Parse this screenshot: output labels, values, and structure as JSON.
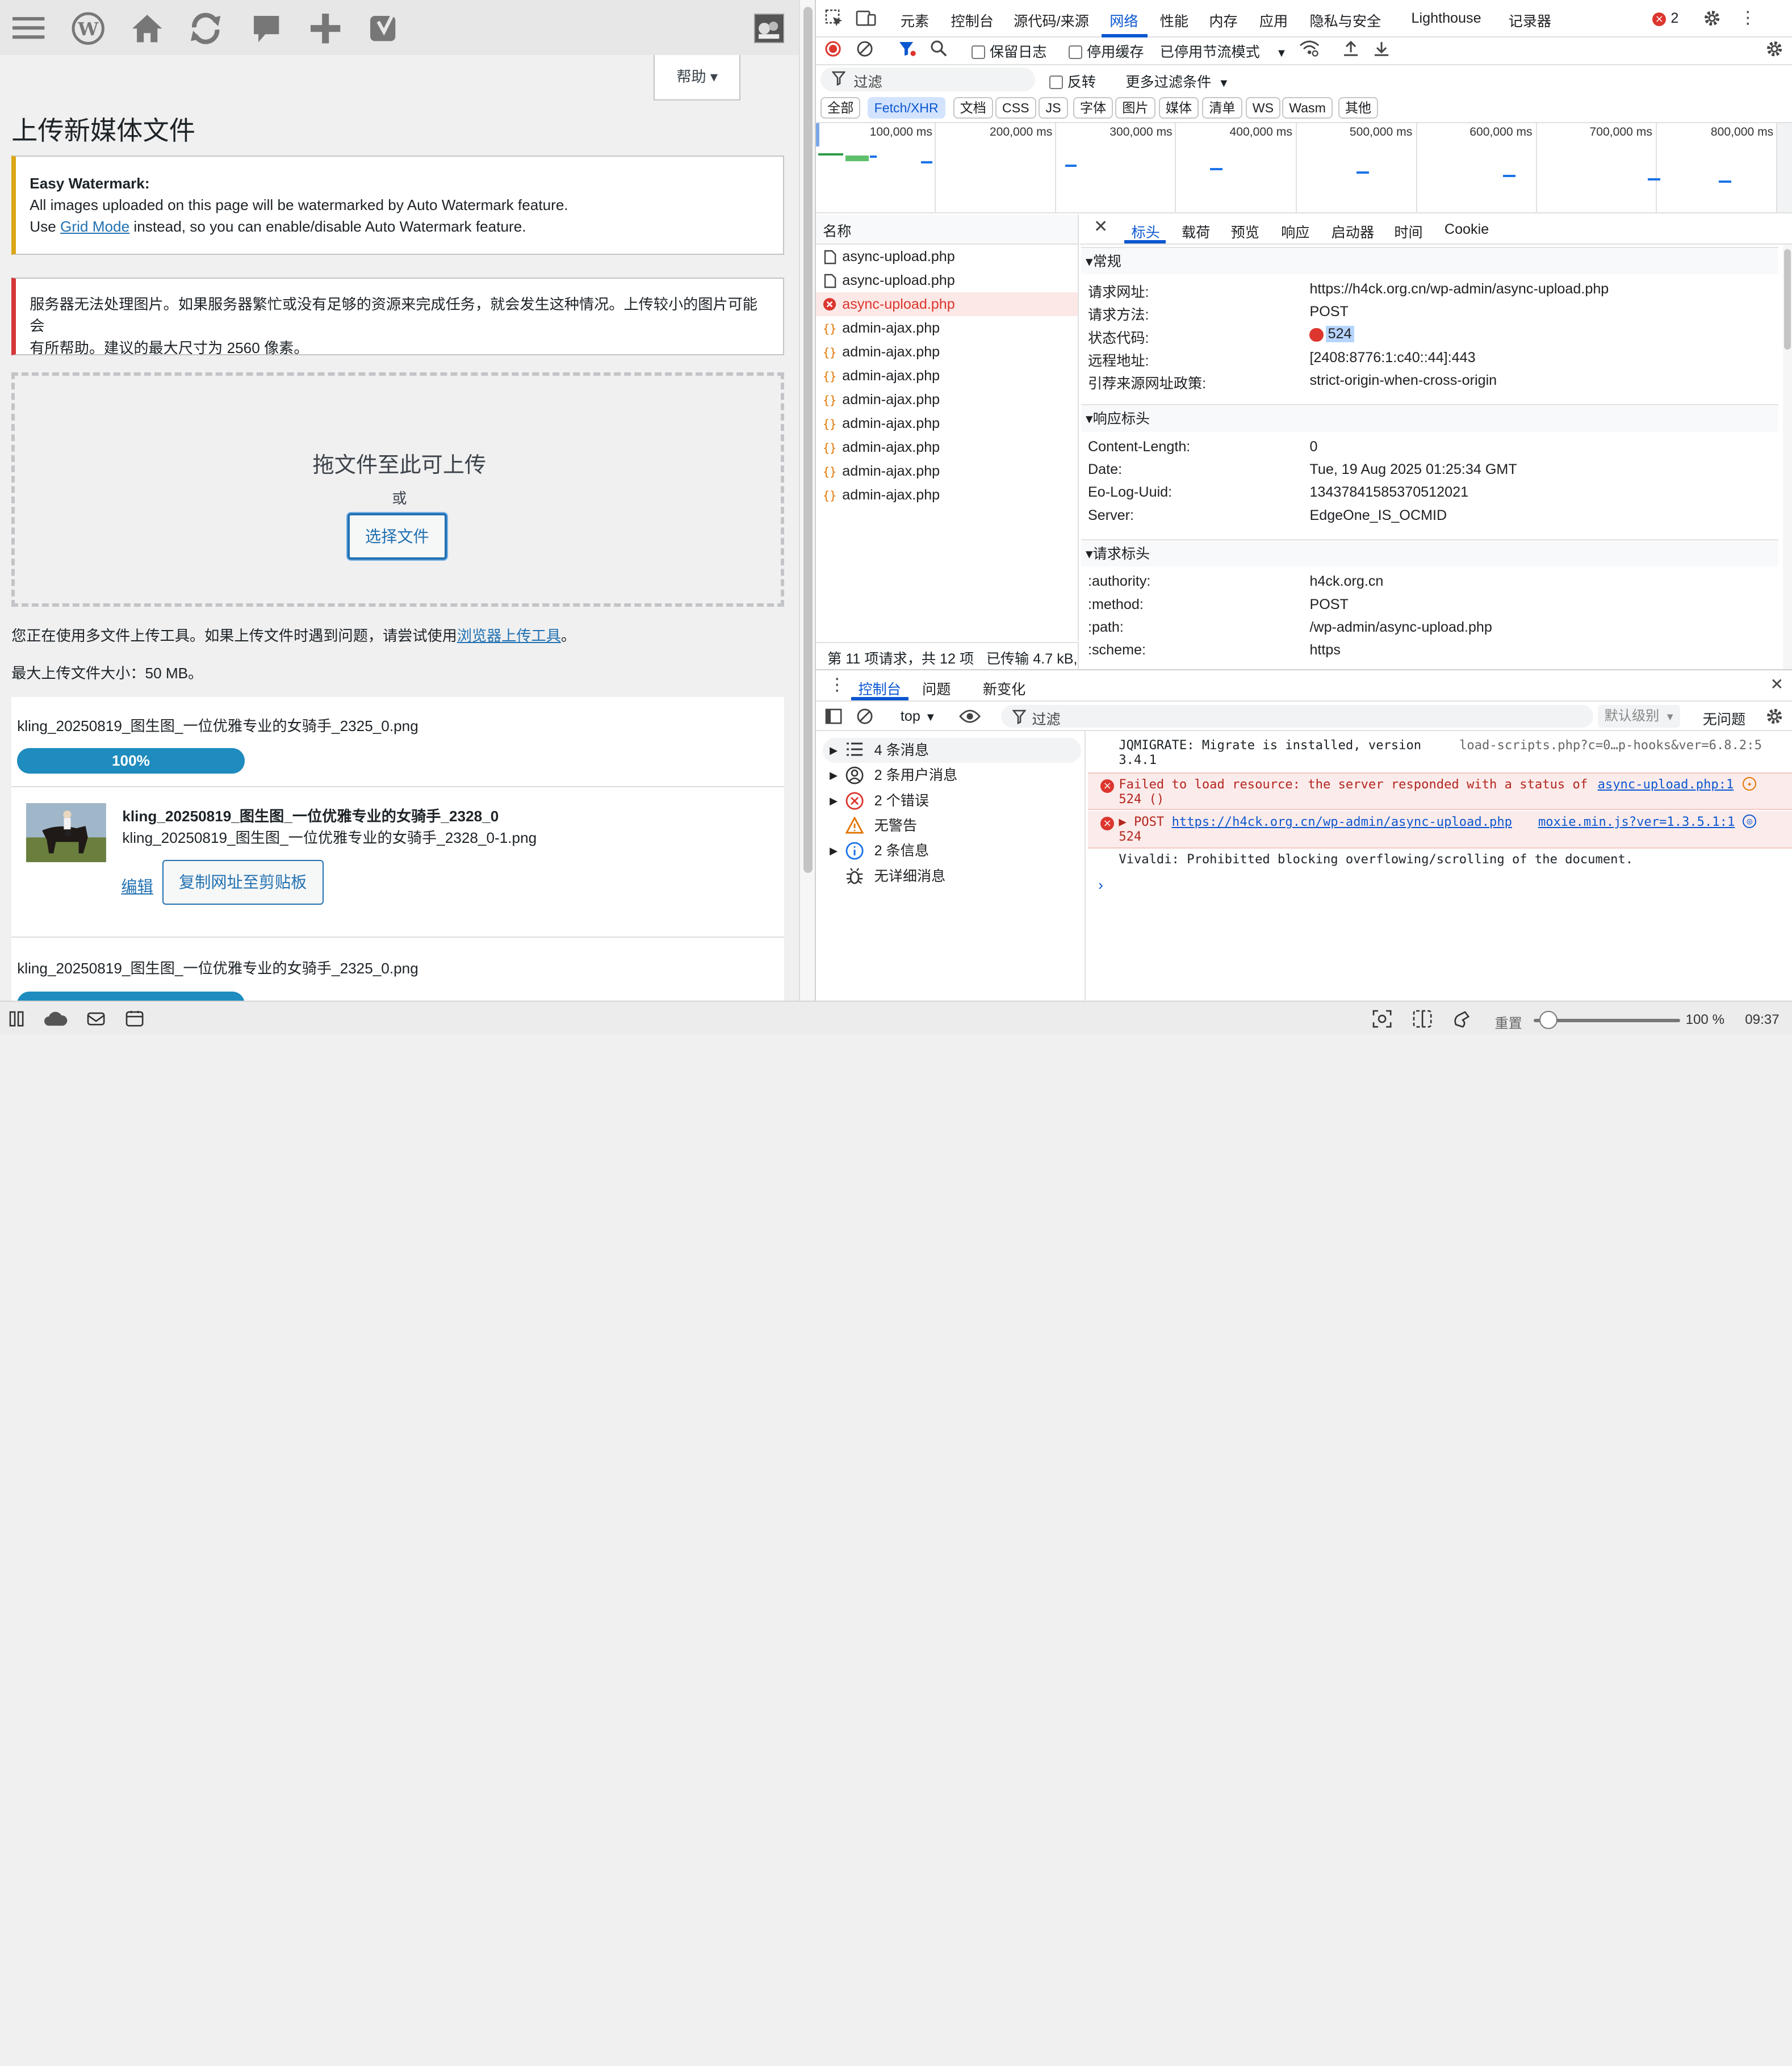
{
  "wp": {
    "help": "帮助",
    "title": "上传新媒体文件",
    "watermark_notice": {
      "title": "Easy Watermark:",
      "line1": "All images uploaded on this page will be watermarked by Auto Watermark feature.",
      "line2_pre": "Use ",
      "line2_link": "Grid Mode",
      "line2_post": " instead, so you can enable/disable Auto Watermark feature."
    },
    "error_notice": {
      "line1": "服务器无法处理图片。如果服务器繁忙或没有足够的资源来完成任务，就会发生这种情况。上传较小的图片可能会",
      "line2": "有所帮助。建议的最大尺寸为 2560 像素。"
    },
    "drop_title": "拖文件至此可上传",
    "drop_or": "或",
    "select_files": "选择文件",
    "multi_uploader_pre": "您正在使用多文件上传工具。如果上传文件时遇到问题，请尝试使用",
    "multi_uploader_link": "浏览器上传工具",
    "multi_uploader_post": "。",
    "max_size": "最大上传文件大小：50 MB。",
    "items": [
      {
        "filename": "kling_20250819_图生图_一位优雅专业的女骑手_2325_0.png",
        "progress": "100%",
        "progress_value": 1.0
      },
      {
        "title": "kling_20250819_图生图_一位优雅专业的女骑手_2328_0",
        "filename": "kling_20250819_图生图_一位优雅专业的女骑手_2328_0-1.png",
        "edit": "编辑",
        "copy_url": "复制网址至剪贴板"
      },
      {
        "filename": "kling_20250819_图生图_一位优雅专业的女骑手_2325_0.png"
      }
    ]
  },
  "devtools": {
    "main_tabs": [
      "元素",
      "控制台",
      "源代码/来源",
      "网络",
      "性能",
      "内存",
      "应用",
      "隐私与安全",
      "Lighthouse",
      "记录器"
    ],
    "active_main_tab": "网络",
    "error_count": "2",
    "toolbar": {
      "preserve_log": "保留日志",
      "disable_cache": "停用缓存",
      "throttle": "已停用节流模式"
    },
    "filter": {
      "placeholder": "过滤",
      "invert": "反转",
      "more_filters": "更多过滤条件"
    },
    "type_chips": [
      "全部",
      "Fetch/XHR",
      "文档",
      "CSS",
      "JS",
      "字体",
      "图片",
      "媒体",
      "清单",
      "WS",
      "Wasm",
      "其他"
    ],
    "active_chip": "Fetch/XHR",
    "timeline_labels": [
      "100,000 ms",
      "200,000 ms",
      "300,000 ms",
      "400,000 ms",
      "500,000 ms",
      "600,000 ms",
      "700,000 ms",
      "800,000 ms"
    ],
    "name_header": "名称",
    "requests": [
      {
        "name": "async-upload.php",
        "type": "doc"
      },
      {
        "name": "async-upload.php",
        "type": "doc"
      },
      {
        "name": "async-upload.php",
        "type": "error"
      },
      {
        "name": "admin-ajax.php",
        "type": "xhr"
      },
      {
        "name": "admin-ajax.php",
        "type": "xhr"
      },
      {
        "name": "admin-ajax.php",
        "type": "xhr"
      },
      {
        "name": "admin-ajax.php",
        "type": "xhr"
      },
      {
        "name": "admin-ajax.php",
        "type": "xhr"
      },
      {
        "name": "admin-ajax.php",
        "type": "xhr"
      },
      {
        "name": "admin-ajax.php",
        "type": "xhr"
      },
      {
        "name": "admin-ajax.php",
        "type": "xhr"
      }
    ],
    "status_bar": {
      "count": "第 11 项请求，共 12 项",
      "transferred": "已传输 4.7 kB,"
    },
    "detail_tabs": [
      "标头",
      "载荷",
      "预览",
      "响应",
      "启动器",
      "时间",
      "Cookie"
    ],
    "active_detail_tab": "标头",
    "general": {
      "title": "常规",
      "rows": [
        {
          "k": "请求网址:",
          "v": "https://h4ck.org.cn/wp-admin/async-upload.php"
        },
        {
          "k": "请求方法:",
          "v": "POST"
        },
        {
          "k": "状态代码:",
          "v": "524"
        },
        {
          "k": "远程地址:",
          "v": "[2408:8776:1:c40::44]:443"
        },
        {
          "k": "引荐来源网址政策:",
          "v": "strict-origin-when-cross-origin"
        }
      ]
    },
    "response_headers": {
      "title": "响应标头",
      "rows": [
        {
          "k": "Content-Length:",
          "v": "0"
        },
        {
          "k": "Date:",
          "v": "Tue, 19 Aug 2025 01:25:34 GMT"
        },
        {
          "k": "Eo-Log-Uuid:",
          "v": "13437841585370512021"
        },
        {
          "k": "Server:",
          "v": "EdgeOne_IS_OCMID"
        }
      ]
    },
    "request_headers": {
      "title": "请求标头",
      "rows": [
        {
          "k": ":authority:",
          "v": "h4ck.org.cn"
        },
        {
          "k": ":method:",
          "v": "POST"
        },
        {
          "k": ":path:",
          "v": "/wp-admin/async-upload.php"
        },
        {
          "k": ":scheme:",
          "v": "https"
        }
      ]
    },
    "console": {
      "tabs": [
        "控制台",
        "问题",
        "新变化"
      ],
      "context": "top",
      "filter_placeholder": "过滤",
      "level": "默认级别",
      "issues": "无问题",
      "sidebar": [
        {
          "label": "4 条消息",
          "icon": "list-icon"
        },
        {
          "label": "2 条用户消息",
          "icon": "user-icon"
        },
        {
          "label": "2 个错误",
          "icon": "error-icon"
        },
        {
          "label": "无警告",
          "icon": "warning-icon"
        },
        {
          "label": "2 条信息",
          "icon": "info-icon"
        },
        {
          "label": "无详细消息",
          "icon": "bug-icon"
        }
      ],
      "messages": [
        {
          "text": "JQMIGRATE: Migrate is installed, version 3.4.1",
          "line1": "JQMIGRATE: Migrate is installed, version",
          "line2": "3.4.1",
          "source": "load-scripts.php?c=0…p-hooks&ver=6.8.2:5"
        },
        {
          "text": "Failed to load resource: the server responded with a status of 524 ()",
          "line1": "Failed to load resource: the server responded with a status of",
          "line2": "524 ()",
          "source": "async-upload.php:1"
        },
        {
          "prefix": "▶ POST ",
          "url": "https://h4ck.org.cn/wp-admin/async-upload.php",
          "line2": "524",
          "source": "moxie.min.js?ver=1.3.5.1:1"
        },
        {
          "text": "Vivaldi: Prohibitted blocking overflowing/scrolling of the document."
        }
      ]
    }
  },
  "bottom": {
    "reset": "重置",
    "zoom": "100 %",
    "zoom_value": 0.1,
    "clock": "09:37"
  },
  "colors": {
    "wp_blue": "#2271b1",
    "progress": "#1e8cbe",
    "error": "#dc362e",
    "devtools_active": "#0b57d0",
    "notice_warn": "#dba617",
    "notice_error": "#d63638"
  }
}
